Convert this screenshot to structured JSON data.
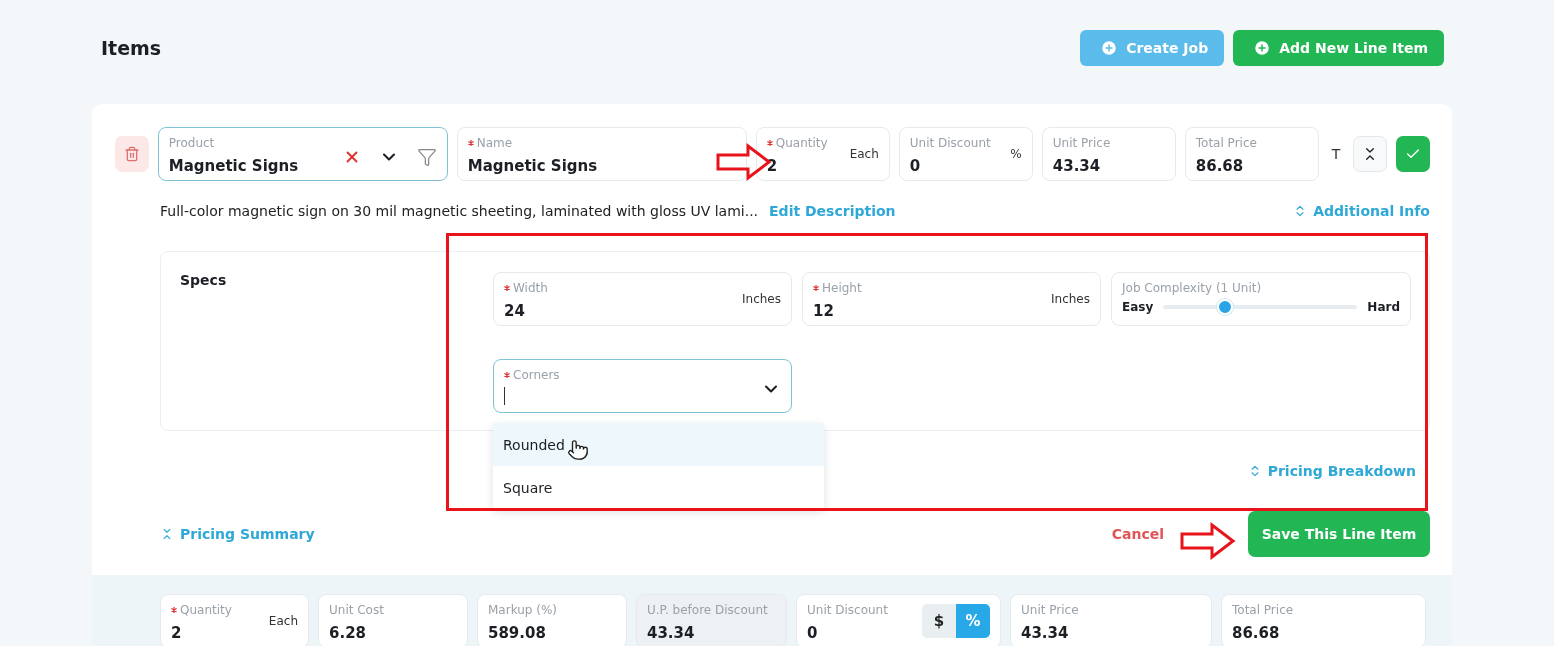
{
  "header": {
    "title": "Items",
    "buttons": [
      {
        "label": "Create Job",
        "kind": "secondary"
      },
      {
        "label": "Add New Line Item",
        "kind": "primary"
      }
    ]
  },
  "line_item": {
    "product": {
      "label": "Product",
      "value": "Magnetic Signs"
    },
    "fields": [
      {
        "label": "Name",
        "value": "Magnetic Signs",
        "required": true
      },
      {
        "label": "Quantity",
        "value": "2",
        "unit": "Each",
        "required": true
      },
      {
        "label": "Unit Discount",
        "value": "0",
        "unit": "%",
        "required": false
      },
      {
        "label": "Unit Price",
        "value": "43.34",
        "required": false
      },
      {
        "label": "Total Price",
        "value": "86.68",
        "required": false
      }
    ],
    "tax_label": "T",
    "description": "Full-color magnetic sign on 30 mil magnetic sheeting, laminated with gloss UV lami...",
    "edit_link": "Edit Description",
    "additional_info": "Additional Info"
  },
  "specs": {
    "title": "Specs",
    "fields": [
      {
        "label": "Width",
        "value": "24",
        "unit": "Inches",
        "required": true
      },
      {
        "label": "Height",
        "value": "12",
        "unit": "Inches",
        "required": true
      }
    ],
    "complexity": {
      "label": "Job Complexity (1 Unit)",
      "min_label": "Easy",
      "max_label": "Hard",
      "level": 0.32
    },
    "corners": {
      "label": "Corners",
      "required": true,
      "options": [
        {
          "label": "Rounded",
          "selected": true
        },
        {
          "label": "Square",
          "selected": false
        }
      ]
    }
  },
  "pricing_breakdown": "Pricing Breakdown",
  "pricing_summary": "Pricing Summary",
  "cancel": "Cancel",
  "save": "Save This Line Item",
  "summary_fields": [
    {
      "label": "Quantity",
      "value": "2",
      "unit": "Each",
      "required": true,
      "disabled": false
    },
    {
      "label": "Unit Cost",
      "value": "6.28",
      "required": false,
      "disabled": false
    },
    {
      "label": "Markup (%)",
      "value": "589.08",
      "required": false,
      "disabled": false
    },
    {
      "label": "U.P. before Discount",
      "value": "43.34",
      "required": false,
      "disabled": true
    },
    {
      "label": "Unit Discount",
      "value": "0",
      "required": false,
      "disabled": false,
      "toggle": [
        {
          "label": "$",
          "selected": false
        },
        {
          "label": "%",
          "selected": true
        }
      ]
    },
    {
      "label": "Unit Price",
      "value": "43.34",
      "required": false,
      "disabled": false
    },
    {
      "label": "Total Price",
      "value": "86.68",
      "required": false,
      "disabled": false
    }
  ]
}
